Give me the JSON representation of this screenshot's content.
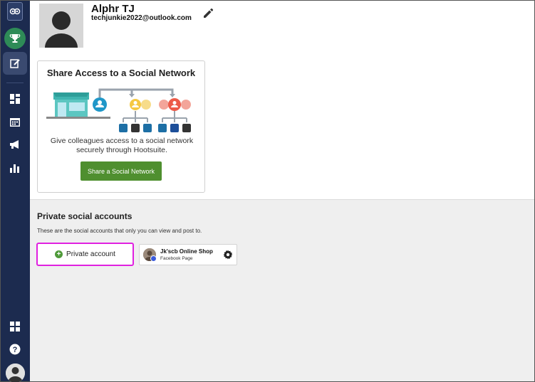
{
  "sidebar": {
    "items": [
      {
        "name": "owl-logo-icon"
      },
      {
        "name": "trophy-icon"
      },
      {
        "name": "compose-icon"
      },
      {
        "name": "dashboard-icon"
      },
      {
        "name": "calendar-icon"
      },
      {
        "name": "megaphone-icon"
      },
      {
        "name": "analytics-icon"
      },
      {
        "name": "apps-grid-icon"
      },
      {
        "name": "help-icon"
      },
      {
        "name": "user-avatar-icon"
      }
    ]
  },
  "profile": {
    "name": "Alphr TJ",
    "email": "techjunkie2022@outlook.com"
  },
  "share_card": {
    "title": "Share Access to a Social Network",
    "description": "Give colleagues access to a social network securely through Hootsuite.",
    "button_label": "Share a Social Network"
  },
  "private_section": {
    "title": "Private social accounts",
    "description": "These are the social accounts that only you can view and post to.",
    "add_button_label": "Private account",
    "accounts": [
      {
        "name": "Jk'scb Online Shop",
        "type": "Facebook Page"
      }
    ]
  },
  "colors": {
    "sidebar": "#1c2b4f",
    "accent_green": "#4f8f2f",
    "highlight": "#e020e0"
  }
}
